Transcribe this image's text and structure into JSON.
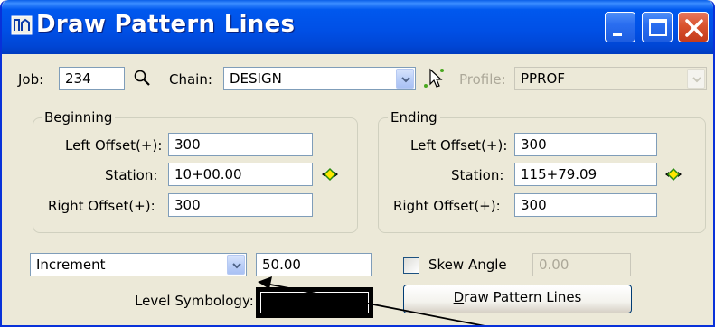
{
  "window": {
    "title": "Draw Pattern Lines"
  },
  "header": {
    "job_label": "Job:",
    "job_value": "234",
    "chain_label": "Chain:",
    "chain_value": "DESIGN",
    "profile_label": "Profile:",
    "profile_value": "PPROF"
  },
  "beginning": {
    "title": "Beginning",
    "left_offset_label": "Left Offset(+):",
    "left_offset_value": "300",
    "station_label": "Station:",
    "station_value": "10+00.00",
    "right_offset_label": "Right Offset(+):",
    "right_offset_value": "300"
  },
  "ending": {
    "title": "Ending",
    "left_offset_label": "Left Offset(+):",
    "left_offset_value": "300",
    "station_label": "Station:",
    "station_value": "115+79.09",
    "right_offset_label": "Right Offset(+):",
    "right_offset_value": "300"
  },
  "options": {
    "mode_value": "Increment",
    "increment_value": "50.00",
    "skew_label": "Skew Angle",
    "skew_checked": false,
    "skew_value": "0.00",
    "level_label": "Level Symbology:",
    "level_color": "#000000",
    "draw_button_first": "D",
    "draw_button_rest": "raw Pattern Lines"
  },
  "colors": {
    "title_bar": "#0054e3",
    "dialog_bg": "#ece9d8",
    "close_button": "#d9532e"
  }
}
